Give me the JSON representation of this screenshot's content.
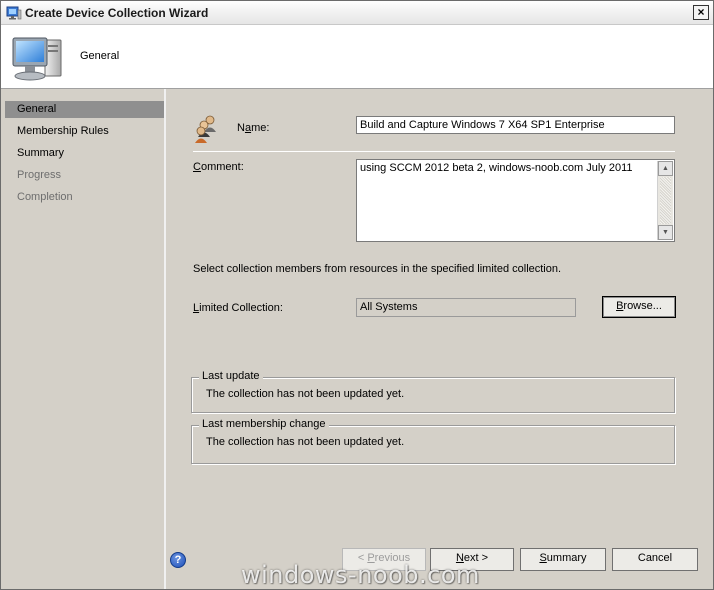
{
  "window": {
    "title": "Create Device Collection Wizard",
    "close_label": "×"
  },
  "header": {
    "page_title": "General"
  },
  "sidebar": {
    "items": [
      {
        "label": "General",
        "state": "active"
      },
      {
        "label": "Membership Rules",
        "state": "enabled"
      },
      {
        "label": "Summary",
        "state": "enabled"
      },
      {
        "label": "Progress",
        "state": "disabled"
      },
      {
        "label": "Completion",
        "state": "disabled"
      }
    ]
  },
  "form": {
    "name_label_prefix": "N",
    "name_label_accel": "a",
    "name_label_suffix": "me:",
    "name_value": "Build and Capture Windows 7 X64 SP1 Enterprise",
    "comment_label_accel": "C",
    "comment_label_rest": "omment:",
    "comment_value": "using SCCM 2012 beta 2, windows-noob.com July 2011",
    "instructions": "Select collection members from resources in the specified limited collection.",
    "limited_label_prefix": "",
    "limited_label_accel": "L",
    "limited_label_rest": "imited Collection:",
    "limited_value": "All Systems",
    "browse_accel": "B",
    "browse_rest": "rowse..."
  },
  "groups": {
    "last_update_title": "Last update",
    "last_update_text": "The collection has not been updated yet.",
    "last_membership_title": "Last membership change",
    "last_membership_text": "The collection has not been updated yet."
  },
  "footer": {
    "help_icon": "?",
    "previous_prefix": "< ",
    "previous_accel": "P",
    "previous_rest": "revious",
    "next_accel": "N",
    "next_rest": "ext >",
    "summary_accel": "S",
    "summary_rest": "ummary",
    "cancel_label": "Cancel"
  },
  "watermark": "windows-noob.com",
  "colors": {
    "dialog_bg": "#d4d0c8",
    "active_nav": "#8f8f8f",
    "help_blue": "#1d4fb8"
  }
}
